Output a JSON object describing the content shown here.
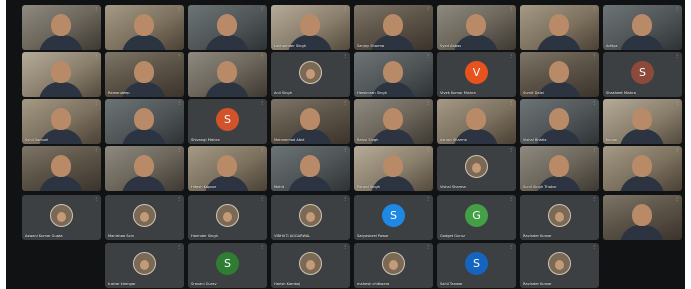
{
  "meeting": {
    "tiles": [
      {
        "name": "",
        "type": "video",
        "initial": "",
        "color": ""
      },
      {
        "name": "",
        "type": "video",
        "initial": "",
        "color": ""
      },
      {
        "name": "",
        "type": "video",
        "initial": "",
        "color": ""
      },
      {
        "name": "Lakhwinder Singh",
        "type": "video",
        "initial": "",
        "color": ""
      },
      {
        "name": "Sanjay Sharma",
        "type": "video",
        "initial": "",
        "color": ""
      },
      {
        "name": "Syed Abbas",
        "type": "video",
        "initial": "",
        "color": ""
      },
      {
        "name": "",
        "type": "video",
        "initial": "",
        "color": ""
      },
      {
        "name": "Aditya",
        "type": "video",
        "initial": "",
        "color": ""
      },
      {
        "name": "",
        "type": "video",
        "initial": "",
        "color": ""
      },
      {
        "name": "Ramandeep",
        "type": "video",
        "initial": "",
        "color": ""
      },
      {
        "name": "",
        "type": "video",
        "initial": "",
        "color": ""
      },
      {
        "name": "Anil Singh",
        "type": "photo",
        "initial": "",
        "color": ""
      },
      {
        "name": "Harsimran Singh",
        "type": "video",
        "initial": "",
        "color": ""
      },
      {
        "name": "Vivek Kumar Mishra",
        "type": "avatar",
        "initial": "V",
        "color": "#e8521d"
      },
      {
        "name": "Sumit Dalal",
        "type": "video",
        "initial": "",
        "color": ""
      },
      {
        "name": "Shasheet Mishra",
        "type": "avatar",
        "initial": "S",
        "color": "#8d4a3b"
      },
      {
        "name": "Sahil Samuel",
        "type": "video",
        "initial": "",
        "color": ""
      },
      {
        "name": "",
        "type": "video",
        "initial": "",
        "color": ""
      },
      {
        "name": "Shivangi Mishra",
        "type": "avatar",
        "initial": "S",
        "color": "#d2532a"
      },
      {
        "name": "Mohammad Abid",
        "type": "video",
        "initial": "",
        "color": ""
      },
      {
        "name": "Rahul Singh",
        "type": "video",
        "initial": "",
        "color": ""
      },
      {
        "name": "Ashish Sharma",
        "type": "video",
        "initial": "",
        "color": ""
      },
      {
        "name": "Vishal Bhatia",
        "type": "video",
        "initial": "",
        "color": ""
      },
      {
        "name": "Kumar",
        "type": "video",
        "initial": "",
        "color": ""
      },
      {
        "name": "",
        "type": "video",
        "initial": "",
        "color": ""
      },
      {
        "name": "",
        "type": "video",
        "initial": "",
        "color": ""
      },
      {
        "name": "Hitesh Kapoor",
        "type": "video",
        "initial": "",
        "color": ""
      },
      {
        "name": "Mohit",
        "type": "video",
        "initial": "",
        "color": ""
      },
      {
        "name": "Pankaj Singh",
        "type": "video",
        "initial": "",
        "color": ""
      },
      {
        "name": "Vishal Sharma",
        "type": "photo",
        "initial": "",
        "color": ""
      },
      {
        "name": "Sunil Singh Thakur",
        "type": "video",
        "initial": "",
        "color": ""
      },
      {
        "name": "",
        "type": "video",
        "initial": "",
        "color": ""
      },
      {
        "name": "Aswani Kumar Gupta",
        "type": "photo",
        "initial": "",
        "color": ""
      },
      {
        "name": "Manishaa Soin",
        "type": "photo",
        "initial": "",
        "color": ""
      },
      {
        "name": "Harinder Singh",
        "type": "photo",
        "initial": "",
        "color": ""
      },
      {
        "name": "VIBHUTI AGGARWAL",
        "type": "photo",
        "initial": "",
        "color": ""
      },
      {
        "name": "Satyasheel Pawar",
        "type": "avatar",
        "initial": "S",
        "color": "#1e88e5"
      },
      {
        "name": "Gadget Guruz",
        "type": "avatar",
        "initial": "G",
        "color": "#43a047"
      },
      {
        "name": "Ravinder Kumar",
        "type": "photo",
        "initial": "",
        "color": ""
      },
      {
        "name": "",
        "type": "video",
        "initial": "",
        "color": ""
      },
      {
        "name": "tushar khengar",
        "type": "photo",
        "initial": "",
        "color": ""
      },
      {
        "name": "Sravani Gurav",
        "type": "avatar",
        "initial": "S",
        "color": "#2e7d32"
      },
      {
        "name": "Harish Kamboj",
        "type": "photo",
        "initial": "",
        "color": ""
      },
      {
        "name": "mahesh chitkaara",
        "type": "photo",
        "initial": "",
        "color": ""
      },
      {
        "name": "Sahil Tanwar",
        "type": "avatar",
        "initial": "S",
        "color": "#1565c0"
      },
      {
        "name": "Ravinder Kumar",
        "type": "photo",
        "initial": "",
        "color": ""
      }
    ]
  }
}
